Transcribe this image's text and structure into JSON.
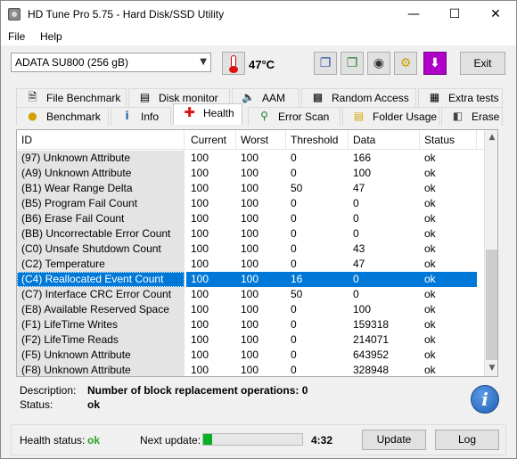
{
  "window": {
    "title": "HD Tune Pro 5.75 - Hard Disk/SSD Utility"
  },
  "menu": {
    "file": "File",
    "help": "Help"
  },
  "toolbar": {
    "drive": "ADATA SU800 (256 gB)",
    "temperature": "47°C",
    "exit_label": "Exit",
    "icons": [
      "copy-text-icon",
      "copy-screenshot-icon",
      "camera-icon",
      "options-icon",
      "save-down-icon"
    ]
  },
  "tabs": {
    "row1": [
      "File Benchmark",
      "Disk monitor",
      "AAM",
      "Random Access",
      "Extra tests"
    ],
    "row2": [
      "Benchmark",
      "Info",
      "Health",
      "Error Scan",
      "Folder Usage",
      "Erase"
    ],
    "active": "Health"
  },
  "grid": {
    "headers": [
      "ID",
      "Current",
      "Worst",
      "Threshold",
      "Data",
      "Status"
    ],
    "rows": [
      {
        "id": "(97) Unknown Attribute",
        "current": "100",
        "worst": "100",
        "threshold": "0",
        "data": "166",
        "status": "ok"
      },
      {
        "id": "(A9) Unknown Attribute",
        "current": "100",
        "worst": "100",
        "threshold": "0",
        "data": "100",
        "status": "ok"
      },
      {
        "id": "(B1) Wear Range Delta",
        "current": "100",
        "worst": "100",
        "threshold": "50",
        "data": "47",
        "status": "ok"
      },
      {
        "id": "(B5) Program Fail Count",
        "current": "100",
        "worst": "100",
        "threshold": "0",
        "data": "0",
        "status": "ok"
      },
      {
        "id": "(B6) Erase Fail Count",
        "current": "100",
        "worst": "100",
        "threshold": "0",
        "data": "0",
        "status": "ok"
      },
      {
        "id": "(BB) Uncorrectable Error Count",
        "current": "100",
        "worst": "100",
        "threshold": "0",
        "data": "0",
        "status": "ok"
      },
      {
        "id": "(C0) Unsafe Shutdown Count",
        "current": "100",
        "worst": "100",
        "threshold": "0",
        "data": "43",
        "status": "ok"
      },
      {
        "id": "(C2) Temperature",
        "current": "100",
        "worst": "100",
        "threshold": "0",
        "data": "47",
        "status": "ok"
      },
      {
        "id": "(C4) Reallocated Event Count",
        "current": "100",
        "worst": "100",
        "threshold": "16",
        "data": "0",
        "status": "ok",
        "selected": true
      },
      {
        "id": "(C7) Interface CRC Error Count",
        "current": "100",
        "worst": "100",
        "threshold": "50",
        "data": "0",
        "status": "ok"
      },
      {
        "id": "(E8) Available Reserved Space",
        "current": "100",
        "worst": "100",
        "threshold": "0",
        "data": "100",
        "status": "ok"
      },
      {
        "id": "(F1) LifeTime Writes",
        "current": "100",
        "worst": "100",
        "threshold": "0",
        "data": "159318",
        "status": "ok"
      },
      {
        "id": "(F2) LifeTime Reads",
        "current": "100",
        "worst": "100",
        "threshold": "0",
        "data": "214071",
        "status": "ok"
      },
      {
        "id": "(F5) Unknown Attribute",
        "current": "100",
        "worst": "100",
        "threshold": "0",
        "data": "643952",
        "status": "ok"
      },
      {
        "id": "(F8) Unknown Attribute",
        "current": "100",
        "worst": "100",
        "threshold": "0",
        "data": "328948",
        "status": "ok"
      }
    ]
  },
  "details": {
    "description_label": "Description:",
    "description_value": "Number of block replacement operations: 0",
    "status_label": "Status:",
    "status_value": "ok"
  },
  "footer": {
    "health_label": "Health status:",
    "health_value": "ok",
    "next_update_label": "Next update:",
    "progress_fraction": 0.09,
    "countdown": "4:32",
    "update_label": "Update",
    "log_label": "Log"
  },
  "colors": {
    "selection": "#0078d7",
    "ok_green": "#2aa52a",
    "progress": "#06b025"
  }
}
